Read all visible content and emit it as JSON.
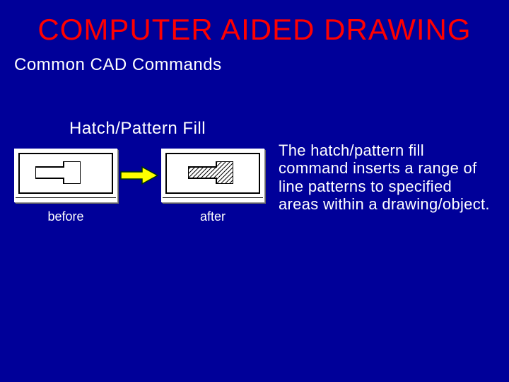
{
  "title": "COMPUTER AIDED DRAWING",
  "subtitle": "Common CAD Commands",
  "feature_title": "Hatch/Pattern Fill",
  "before_label": "before",
  "after_label": "after",
  "description": "The hatch/pattern fill command inserts a range of line patterns to specified areas within a drawing/object.",
  "colors": {
    "background": "#000099",
    "title": "#ff0000",
    "text": "#ffffff",
    "arrow_fill": "#ffff00",
    "arrow_stroke": "#003300"
  }
}
